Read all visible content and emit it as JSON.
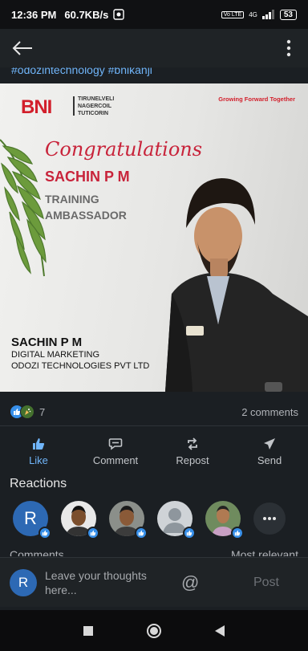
{
  "status_bar": {
    "time": "12:36 PM",
    "net_speed": "60.7KB/s",
    "network": "4G",
    "battery": "53"
  },
  "post": {
    "hashtags": "#odozintechnology #bnikanji",
    "poster": {
      "bni_logo": "BNI",
      "chapter_lines": [
        "TIRUNELVELI",
        "NAGERCOIL",
        "TUTICORIN"
      ],
      "slogan": "Growing Forward Together",
      "congrats": "Congratulations",
      "awardee": "SACHIN P M",
      "role_lines": [
        "TRAINING",
        "AMBASSADOR"
      ],
      "person_name": "SACHIN P M",
      "person_title": "DIGITAL MARKETING",
      "person_company": "ODOZI TECHNOLOGIES PVT LTD"
    },
    "reaction_count": "7",
    "comments_count": "2 comments"
  },
  "actions": [
    {
      "label": "Like",
      "icon": "like-icon",
      "active": true
    },
    {
      "label": "Comment",
      "icon": "comment-icon",
      "active": false
    },
    {
      "label": "Repost",
      "icon": "repost-icon",
      "active": false
    },
    {
      "label": "Send",
      "icon": "send-icon",
      "active": false
    }
  ],
  "reactions_section": {
    "title": "Reactions",
    "avatar_initial": "R"
  },
  "comments_peek": {
    "heading": "Comments",
    "sort": "Most relevant"
  },
  "comment_bar": {
    "avatar_initial": "R",
    "placeholder_line1": "Leave your thoughts",
    "placeholder_line2": "here...",
    "at_symbol": "@",
    "post_label": "Post"
  },
  "colors": {
    "background": "#1b1f23",
    "accent_blue": "#70b5f9",
    "bni_red": "#d21f2b"
  }
}
